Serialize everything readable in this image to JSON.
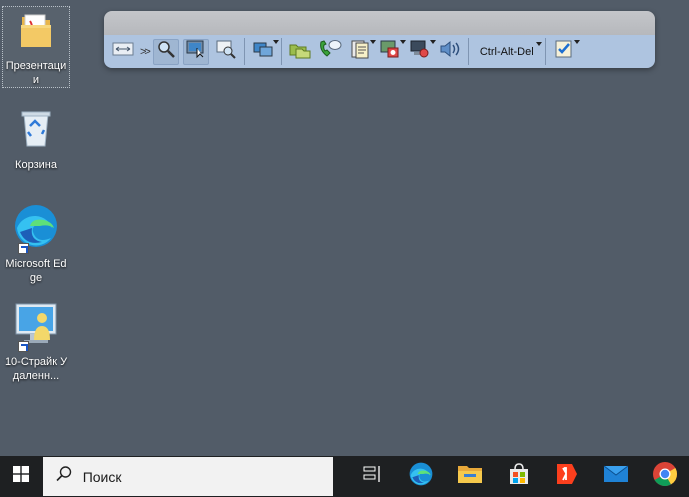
{
  "desktop": {
    "icons": [
      {
        "label": "Презентации",
        "icon": "folder-icon"
      },
      {
        "label": "Корзина",
        "icon": "recycle-bin-icon"
      },
      {
        "label": "Microsoft Edge",
        "icon": "edge-icon"
      },
      {
        "label": "10-Страйк Удаленн...",
        "icon": "remote-admin-icon"
      }
    ]
  },
  "remote_toolbar": {
    "ctrl_alt_del_label": "Ctrl-Alt-Del",
    "more_label": ">>"
  },
  "taskbar": {
    "search_placeholder": "Поиск",
    "apps": [
      "task-view-icon",
      "edge-icon",
      "file-explorer-icon",
      "store-icon",
      "yandex-icon",
      "mail-icon",
      "chrome-icon"
    ]
  },
  "colors": {
    "desktop_bg": "#525c68",
    "taskbar_bg": "#1e2022",
    "toolbar_bg": "#aec4e0"
  }
}
